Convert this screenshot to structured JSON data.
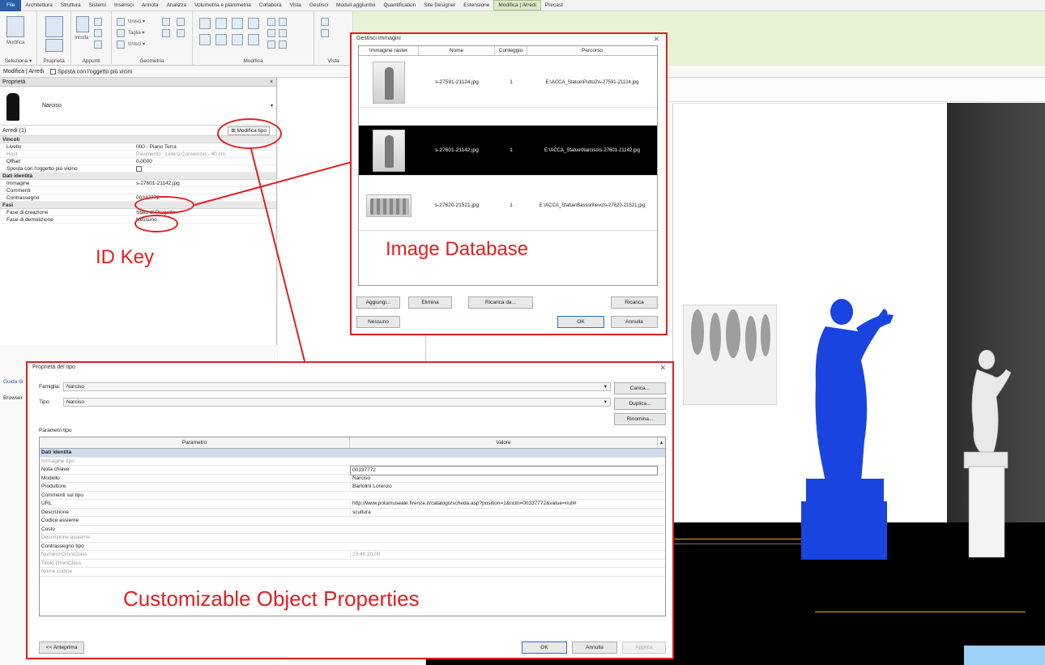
{
  "menu": {
    "tabs": [
      "File",
      "Architettura",
      "Struttura",
      "Sistemi",
      "Inserisci",
      "Annota",
      "Analizza",
      "Volumetria e planimetria",
      "Collabora",
      "Vista",
      "Gestisci",
      "Moduli aggiuntivi",
      "Quantification",
      "Site Designer",
      "Estensione",
      "Modifica | Arredi",
      "Precast"
    ]
  },
  "ribbon": {
    "modify_label": "Modifica",
    "groups": [
      "Seleziona ▾",
      "Proprietà",
      "Appunti",
      "Geometria",
      "Modifica",
      "Vista"
    ],
    "small_labels": [
      "Unisci ▾",
      "Taglia ▾",
      "Unisci ▾",
      "Incolla"
    ]
  },
  "optionbar": {
    "context": "Modifica | Arredi",
    "option": "Sposta con l'oggetto più vicini"
  },
  "properties": {
    "header": "Proprietà",
    "close": "×",
    "type_name": "Narciso",
    "filter": "Arredi (1)",
    "edit_type": "Modifica tipo",
    "categories": [
      {
        "name": "Vincoli",
        "rows": [
          {
            "k": "Livello",
            "v": "000 - Piano Terra"
          },
          {
            "k": "Host",
            "v": "Pavimento : Lidero Convenzio - 40 cm",
            "dim": true
          },
          {
            "k": "Offset",
            "v": "0.0000"
          },
          {
            "k": "Sposta con l'oggetto più vicino",
            "v": ""
          }
        ]
      },
      {
        "name": "Dati identità",
        "rows": [
          {
            "k": "Immagine",
            "v": "s-27601-21142.jpg"
          },
          {
            "k": "Commenti",
            "v": ""
          },
          {
            "k": "Contrassegno",
            "v": "00337772"
          }
        ]
      },
      {
        "name": "Fasi",
        "rows": [
          {
            "k": "Fase di creazione",
            "v": "Stato di Progetto"
          },
          {
            "k": "Fase di demolizione",
            "v": "Nessuno"
          }
        ]
      }
    ]
  },
  "side_links": {
    "guide": "Guida di",
    "browser": "Browser"
  },
  "callouts": {
    "id_key": "ID Key",
    "image_db": "Image Database",
    "object_props": "Customizable Object Properties"
  },
  "image_dialog": {
    "title": "Gestisci immagini",
    "close": "✕",
    "columns": [
      "Immagine raster",
      "Nome",
      "Conteggio",
      "Percorso"
    ],
    "rows": [
      {
        "name": "s-27591-21124.jpg",
        "count": "1",
        "path": "E:\\ACCA_Statue\\Putto2\\s-27591-21124.jpg",
        "selected": false
      },
      {
        "name": "s-27601-21142.jpg",
        "count": "1",
        "path": "E:\\ACCA_Statue\\Narciso\\s-27601-21142.jpg",
        "selected": true
      },
      {
        "name": "s-27620-21521.jpg",
        "count": "1",
        "path": "E:\\ACCA_Statue\\Bassorilievo\\s-27620-21521.jpg",
        "selected": false
      }
    ],
    "buttons": {
      "add": "Aggiungi...",
      "delete": "Elimina",
      "reload_from": "Ricarica da...",
      "reload": "Ricarica",
      "none": "Nessuno",
      "ok": "OK",
      "cancel": "Annulla"
    }
  },
  "type_dialog": {
    "title": "Proprietà del tipo",
    "close": "✕",
    "family_label": "Famiglia:",
    "family_value": "Narciso",
    "type_label": "Tipo:",
    "type_value": "Narciso",
    "btn_load": "Carica...",
    "btn_duplicate": "Duplica...",
    "btn_rename": "Rinomina...",
    "params_label": "Parametri tipo",
    "col_param": "Parametro",
    "col_value": "Valore",
    "rows": [
      {
        "k": "Dati identità",
        "v": "",
        "cat": true
      },
      {
        "k": "Immagine tipo",
        "v": "",
        "dim": true
      },
      {
        "k": "Nota chiave",
        "v": "00337772",
        "boxed": true
      },
      {
        "k": "Modello",
        "v": "Narciso"
      },
      {
        "k": "Produttore",
        "v": "Bartolini Lorenzo"
      },
      {
        "k": "Commenti sul tipo",
        "v": ""
      },
      {
        "k": "URL",
        "v": "http://www.polomuseale.firenze.it/catalogo/scheda.asp?position=1&nctn=00337772&value=null#"
      },
      {
        "k": "Descrizione",
        "v": "scultura"
      },
      {
        "k": "Codice assieme",
        "v": ""
      },
      {
        "k": "Costo",
        "v": ""
      },
      {
        "k": "Descrizione assieme",
        "v": "",
        "dim": true
      },
      {
        "k": "Contrassegno tipo",
        "v": ""
      },
      {
        "k": "Numero OmniClass",
        "v": "23.40.20.00",
        "dim": true
      },
      {
        "k": "Titolo OmniClass",
        "v": "",
        "dim": true
      },
      {
        "k": "Nome codice",
        "v": "",
        "dim": true
      }
    ],
    "btn_preview": "<< Anteprima",
    "btn_ok": "OK",
    "btn_cancel": "Annulla",
    "btn_apply": "Applica"
  },
  "colors": {
    "callout_red": "#e02020",
    "selection_blue": "#1a44e0",
    "active_tab": "#dbe9c6"
  }
}
